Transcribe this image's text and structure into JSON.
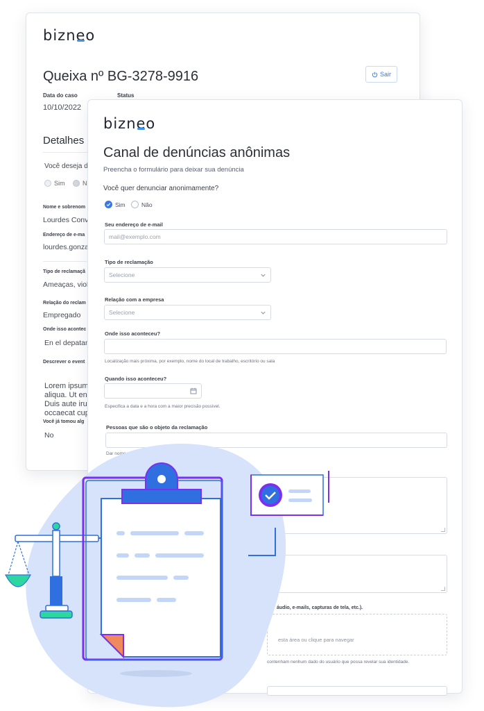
{
  "back": {
    "logo": "bizneo",
    "title": "Queixa nº BG-3278-9916",
    "exit_label": "Sair",
    "case_date_label": "Data do caso",
    "case_date": "10/10/2022",
    "status_label": "Status",
    "details_heading": "Detalhes",
    "anon_question": "Você deseja de",
    "radio_yes": "Sim",
    "radio_no": "Nã",
    "name_label": "Nome e sobrenom",
    "name_value": "Lourdes Conve",
    "email_label": "Endereço de e-ma",
    "email_value": "lourdes.gonzal",
    "complaint_type_label": "Tipo de reclamaçã",
    "complaint_type_value": "Ameaças, violê",
    "relation_label": "Relação do reclam",
    "relation_value": "Empregado",
    "where_label": "Onde isso acontec",
    "where_value": "En el depatam",
    "describe_label": "Descrever o event",
    "describe_lines": [
      "Lorem ipsum d",
      "aliqua. Ut enim",
      "Duis aute irure",
      "occaecat cupid"
    ],
    "acted_label": "Você já tomou alg",
    "acted_value": "No"
  },
  "form": {
    "logo": "bizneo",
    "title": "Canal de denúncias anônimas",
    "subtitle": "Preencha o formulário para deixar sua denúncia",
    "anon_question": "Você quer denunciar anonimamente?",
    "yes_label": "Sim",
    "no_label": "Não",
    "email_label": "Seu endereço de e-mail",
    "email_placeholder": "mail@exemplo.com",
    "complaint_type_label": "Tipo de reclamação",
    "complaint_type_value": "Selecione",
    "relation_label": "Relação com a empresa",
    "relation_value": "Selecione",
    "where_label": "Onde isso aconteceu?",
    "where_help": "Localização mais próxima, por exemplo, nome do local de trabalho, escritório ou sala",
    "when_label": "Quando isso aconteceu?",
    "when_help": "Especifica a data e a hora com a maior precisão possível.",
    "people_label": "Pessoas que são o objeto da reclamação",
    "people_help": "Dar nome e sobre",
    "attach_label": "áudio, e-mails, capturas de tela, etc.).",
    "drop_text": "esta área ou clique para navegar",
    "privacy_note": "contenham nenhum dado do usuário que possa revelar sua identidade."
  },
  "colors": {
    "accent": "#3479e6",
    "blob": "#d6e3fb",
    "purple": "#7b2ff0",
    "green": "#2ed7a0",
    "orange": "#f08a5d"
  }
}
